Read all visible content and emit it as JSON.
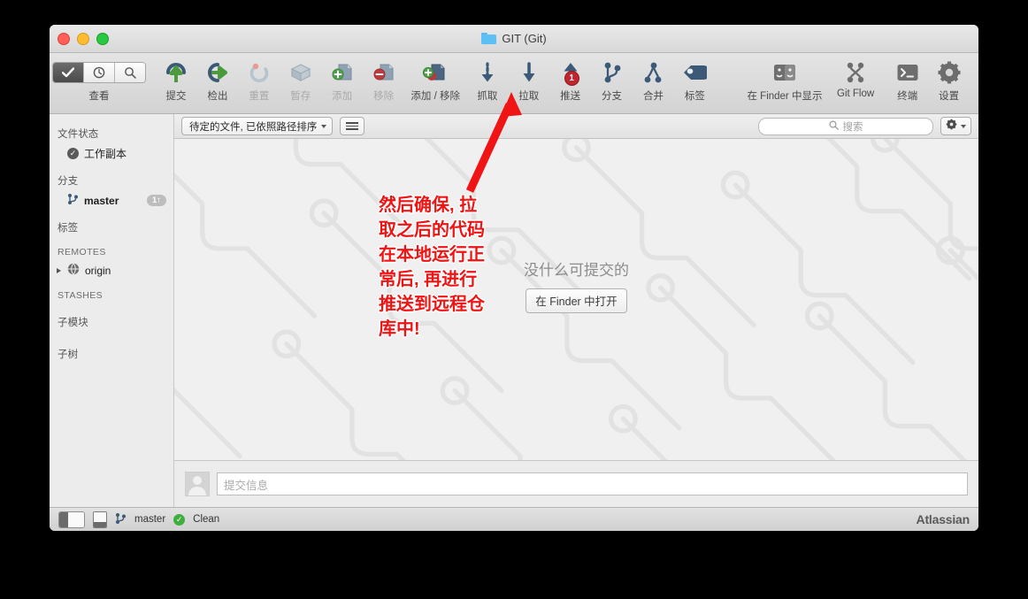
{
  "window": {
    "title": "GIT (Git)",
    "folder_icon": "folder-icon"
  },
  "toolbar": {
    "view_group_label": "查看",
    "view_segments": [
      {
        "icon": "check-icon",
        "active": true
      },
      {
        "icon": "clock-icon",
        "active": false
      },
      {
        "icon": "search-icon",
        "active": false
      }
    ],
    "items": [
      {
        "label": "提交",
        "icon": "commit-icon",
        "disabled": false,
        "badge": ""
      },
      {
        "label": "检出",
        "icon": "checkout-icon",
        "disabled": false,
        "badge": ""
      },
      {
        "label": "重置",
        "icon": "reset-icon",
        "disabled": true,
        "badge": ""
      },
      {
        "label": "暂存",
        "icon": "stash-icon",
        "disabled": true,
        "badge": ""
      },
      {
        "label": "添加",
        "icon": "add-icon",
        "disabled": true,
        "badge": ""
      },
      {
        "label": "移除",
        "icon": "remove-icon",
        "disabled": true,
        "badge": ""
      },
      {
        "label": "添加 / 移除",
        "icon": "add-remove-icon",
        "disabled": false,
        "badge": ""
      },
      {
        "label": "抓取",
        "icon": "fetch-icon",
        "disabled": false,
        "badge": ""
      },
      {
        "label": "拉取",
        "icon": "pull-icon",
        "disabled": false,
        "badge": ""
      },
      {
        "label": "推送",
        "icon": "push-icon",
        "disabled": false,
        "badge": "1"
      },
      {
        "label": "分支",
        "icon": "branch-icon",
        "disabled": false,
        "badge": ""
      },
      {
        "label": "合并",
        "icon": "merge-icon",
        "disabled": false,
        "badge": ""
      },
      {
        "label": "标签",
        "icon": "tag-icon",
        "disabled": false,
        "badge": ""
      }
    ],
    "right_items": [
      {
        "label": "在 Finder 中显示",
        "icon": "finder-icon"
      },
      {
        "label": "Git Flow",
        "icon": "gitflow-icon"
      },
      {
        "label": "终端",
        "icon": "terminal-icon"
      }
    ],
    "settings": {
      "label": "设置",
      "icon": "gear-icon"
    }
  },
  "sidebar": {
    "sections": [
      {
        "header": "文件状态",
        "caps": false,
        "rows": [
          {
            "label": "工作副本",
            "icon": "check-circle-icon",
            "bold": false,
            "count": "",
            "disclosure": false
          }
        ]
      },
      {
        "header": "分支",
        "caps": false,
        "rows": [
          {
            "label": "master",
            "icon": "branch-icon",
            "bold": true,
            "count": "1↑",
            "disclosure": false
          }
        ]
      },
      {
        "header": "标签",
        "caps": false,
        "rows": []
      },
      {
        "header": "REMOTES",
        "caps": true,
        "rows": [
          {
            "label": "origin",
            "icon": "globe-icon",
            "bold": false,
            "count": "",
            "disclosure": true
          }
        ]
      },
      {
        "header": "STASHES",
        "caps": true,
        "rows": []
      },
      {
        "header": "子模块",
        "caps": false,
        "rows": []
      },
      {
        "header": "子树",
        "caps": false,
        "rows": []
      }
    ]
  },
  "filterbar": {
    "filter_label": "待定的文件, 已依照路径排序",
    "list_button_icon": "list-view-icon",
    "search_placeholder": "搜索",
    "search_icon": "search-icon",
    "gear_icon": "gear-icon",
    "gear_chevron_icon": "chevron-down-icon"
  },
  "main": {
    "empty_title": "没什么可提交的",
    "finder_button": "在 Finder 中打开"
  },
  "commit": {
    "message_placeholder": "提交信息",
    "avatar_icon": "avatar-icon"
  },
  "statusbar": {
    "sidebar_toggle_icon": "sidebar-toggle-icon",
    "panel_toggle_icon": "panel-toggle-icon",
    "branch_icon": "branch-icon",
    "branch": "master",
    "status_icon": "green-check-icon",
    "status": "Clean",
    "brand": "Atlassian"
  },
  "annotation": {
    "lines": [
      "然后确保, 拉",
      "取之后的代码",
      "在本地运行正",
      "常后, 再进行",
      "推送到远程仓",
      "库中!"
    ],
    "color": "#ef1414",
    "arrow_icon": "red-arrow-icon"
  }
}
